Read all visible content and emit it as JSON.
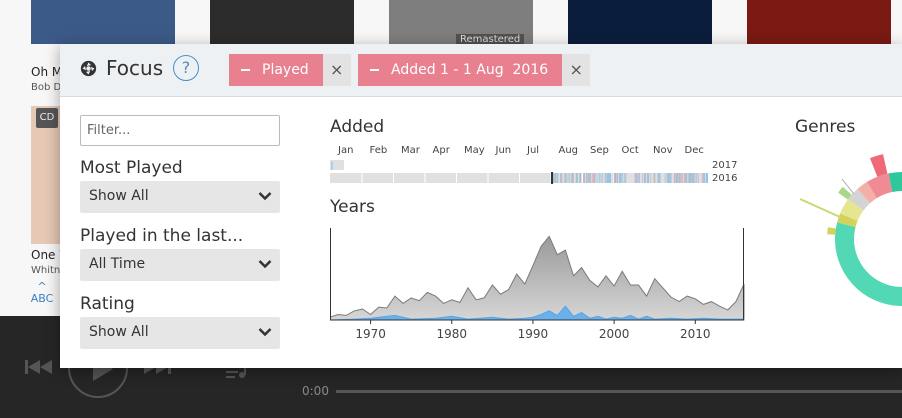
{
  "background": {
    "albums": [
      {
        "title": "Oh M",
        "artist": "Bob D",
        "art_color": "#3c5a88"
      },
      {
        "art_color": "#2c2c2c"
      },
      {
        "art_color": "#888888",
        "badge": "Remastered"
      },
      {
        "art_color": "#0b1d3c"
      },
      {
        "art_color": "#7a1a12"
      }
    ],
    "second_row": {
      "badge": "CD",
      "title": "One W",
      "artist": "Whitn"
    },
    "alpha_nav": "ABC",
    "player": {
      "time": "0:00"
    }
  },
  "focus": {
    "title": "Focus",
    "help_label": "?",
    "chips": [
      {
        "label": "Played",
        "remove": "×"
      },
      {
        "label": "Added 1 - 1 Aug  2016",
        "remove": "×"
      }
    ],
    "filter_placeholder": "Filter...",
    "most_played": {
      "label": "Most Played",
      "value": "Show All"
    },
    "played_last": {
      "label": "Played in the last...",
      "value": "All Time"
    },
    "rating": {
      "label": "Rating",
      "value": "Show All"
    },
    "added": {
      "title": "Added",
      "months": [
        "Jan",
        "Feb",
        "Mar",
        "Apr",
        "May",
        "Jun",
        "Jul",
        "Aug",
        "Sep",
        "Oct",
        "Nov",
        "Dec"
      ],
      "rows": [
        "2017",
        "2016"
      ]
    },
    "years": {
      "title": "Years"
    },
    "genres": {
      "title": "Genres"
    }
  },
  "chart_data": [
    {
      "type": "area",
      "title": "Years",
      "xlabel": "",
      "ylabel": "",
      "xlim": [
        1965,
        2016
      ],
      "ylim": [
        0,
        100
      ],
      "x_ticks": [
        1970,
        1980,
        1990,
        2000,
        2010
      ],
      "grid": false,
      "series": [
        {
          "values": [
            [
              1965,
              3
            ],
            [
              1966,
              6
            ],
            [
              1967,
              5
            ],
            [
              1968,
              10
            ],
            [
              1969,
              12
            ],
            [
              1970,
              6
            ],
            [
              1971,
              14
            ],
            [
              1972,
              13
            ],
            [
              1973,
              26
            ],
            [
              1974,
              18
            ],
            [
              1975,
              24
            ],
            [
              1976,
              21
            ],
            [
              1977,
              30
            ],
            [
              1978,
              26
            ],
            [
              1979,
              18
            ],
            [
              1980,
              22
            ],
            [
              1981,
              19
            ],
            [
              1982,
              35
            ],
            [
              1983,
              22
            ],
            [
              1984,
              24
            ],
            [
              1985,
              38
            ],
            [
              1986,
              28
            ],
            [
              1987,
              33
            ],
            [
              1988,
              50
            ],
            [
              1989,
              39
            ],
            [
              1990,
              59
            ],
            [
              1991,
              80
            ],
            [
              1992,
              91
            ],
            [
              1993,
              71
            ],
            [
              1994,
              76
            ],
            [
              1995,
              48
            ],
            [
              1996,
              57
            ],
            [
              1997,
              43
            ],
            [
              1998,
              36
            ],
            [
              1999,
              48
            ],
            [
              2000,
              37
            ],
            [
              2001,
              53
            ],
            [
              2002,
              38
            ],
            [
              2003,
              38
            ],
            [
              2004,
              26
            ],
            [
              2005,
              45
            ],
            [
              2006,
              35
            ],
            [
              2007,
              25
            ],
            [
              2008,
              20
            ],
            [
              2009,
              26
            ],
            [
              2010,
              23
            ],
            [
              2011,
              17
            ],
            [
              2012,
              20
            ],
            [
              2013,
              15
            ],
            [
              2014,
              11
            ],
            [
              2015,
              20
            ],
            [
              2016,
              39
            ]
          ],
          "color": "#b5b5b5"
        },
        {
          "values": [
            [
              1965,
              0
            ],
            [
              1968,
              1
            ],
            [
              1970,
              2
            ],
            [
              1973,
              5
            ],
            [
              1975,
              1
            ],
            [
              1978,
              2
            ],
            [
              1980,
              4
            ],
            [
              1982,
              1
            ],
            [
              1985,
              3
            ],
            [
              1987,
              1
            ],
            [
              1989,
              2
            ],
            [
              1990,
              3
            ],
            [
              1991,
              6
            ],
            [
              1992,
              10
            ],
            [
              1993,
              5
            ],
            [
              1994,
              15
            ],
            [
              1995,
              4
            ],
            [
              1996,
              8
            ],
            [
              1997,
              2
            ],
            [
              1998,
              4
            ],
            [
              1999,
              1
            ],
            [
              2000,
              3
            ],
            [
              2001,
              2
            ],
            [
              2002,
              5
            ],
            [
              2003,
              1
            ],
            [
              2004,
              4
            ],
            [
              2005,
              1
            ],
            [
              2007,
              2
            ],
            [
              2009,
              1
            ],
            [
              2011,
              2
            ],
            [
              2013,
              1
            ],
            [
              2016,
              1
            ]
          ],
          "color": "#6ab0ea"
        }
      ]
    },
    {
      "type": "pie",
      "title": "Genres",
      "slices": [
        {
          "value": 270,
          "color": "#52d8b4"
        },
        {
          "value": 8,
          "color": "#d2d25c"
        },
        {
          "value": 14,
          "color": "#e6e690"
        },
        {
          "value": 12,
          "color": "#d4d4d4"
        },
        {
          "value": 10,
          "color": "#f4b0a8"
        },
        {
          "value": 20,
          "color": "#f08a94"
        },
        {
          "value": 26,
          "color": "#2fc89c"
        }
      ]
    }
  ]
}
